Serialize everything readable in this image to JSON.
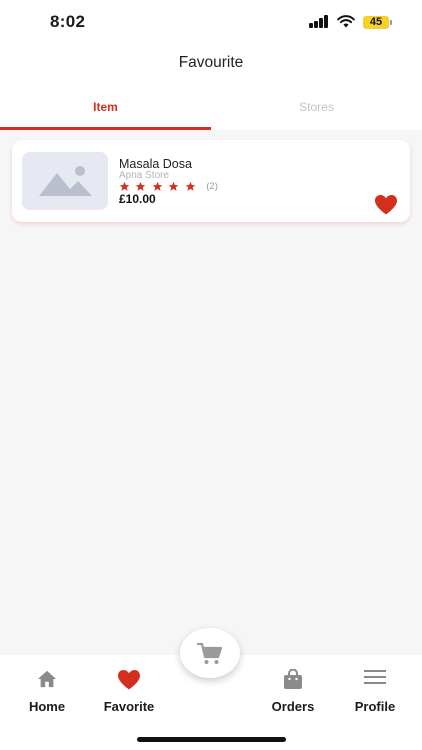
{
  "status_bar": {
    "time": "8:02",
    "battery": "45"
  },
  "header": {
    "title": "Favourite"
  },
  "tabs": [
    {
      "label": "Item",
      "active": true
    },
    {
      "label": "Stores",
      "active": false
    }
  ],
  "favorites": [
    {
      "name": "Masala Dosa",
      "store": "Apna Store",
      "rating_stars": 5,
      "rating_count": "(2)",
      "price": "£10.00",
      "favorited": true
    }
  ],
  "bottom_nav": [
    {
      "label": "Home",
      "icon": "home-icon",
      "active": false
    },
    {
      "label": "Favorite",
      "icon": "heart-icon",
      "active": true
    },
    {
      "label": "Orders",
      "icon": "bag-icon",
      "active": false
    },
    {
      "label": "Profile",
      "icon": "menu-icon",
      "active": false
    }
  ],
  "colors": {
    "accent": "#d32f1e",
    "inactive": "#c4c4c4",
    "icon_gray": "#8a8a8a",
    "background": "#f6f6f6"
  }
}
